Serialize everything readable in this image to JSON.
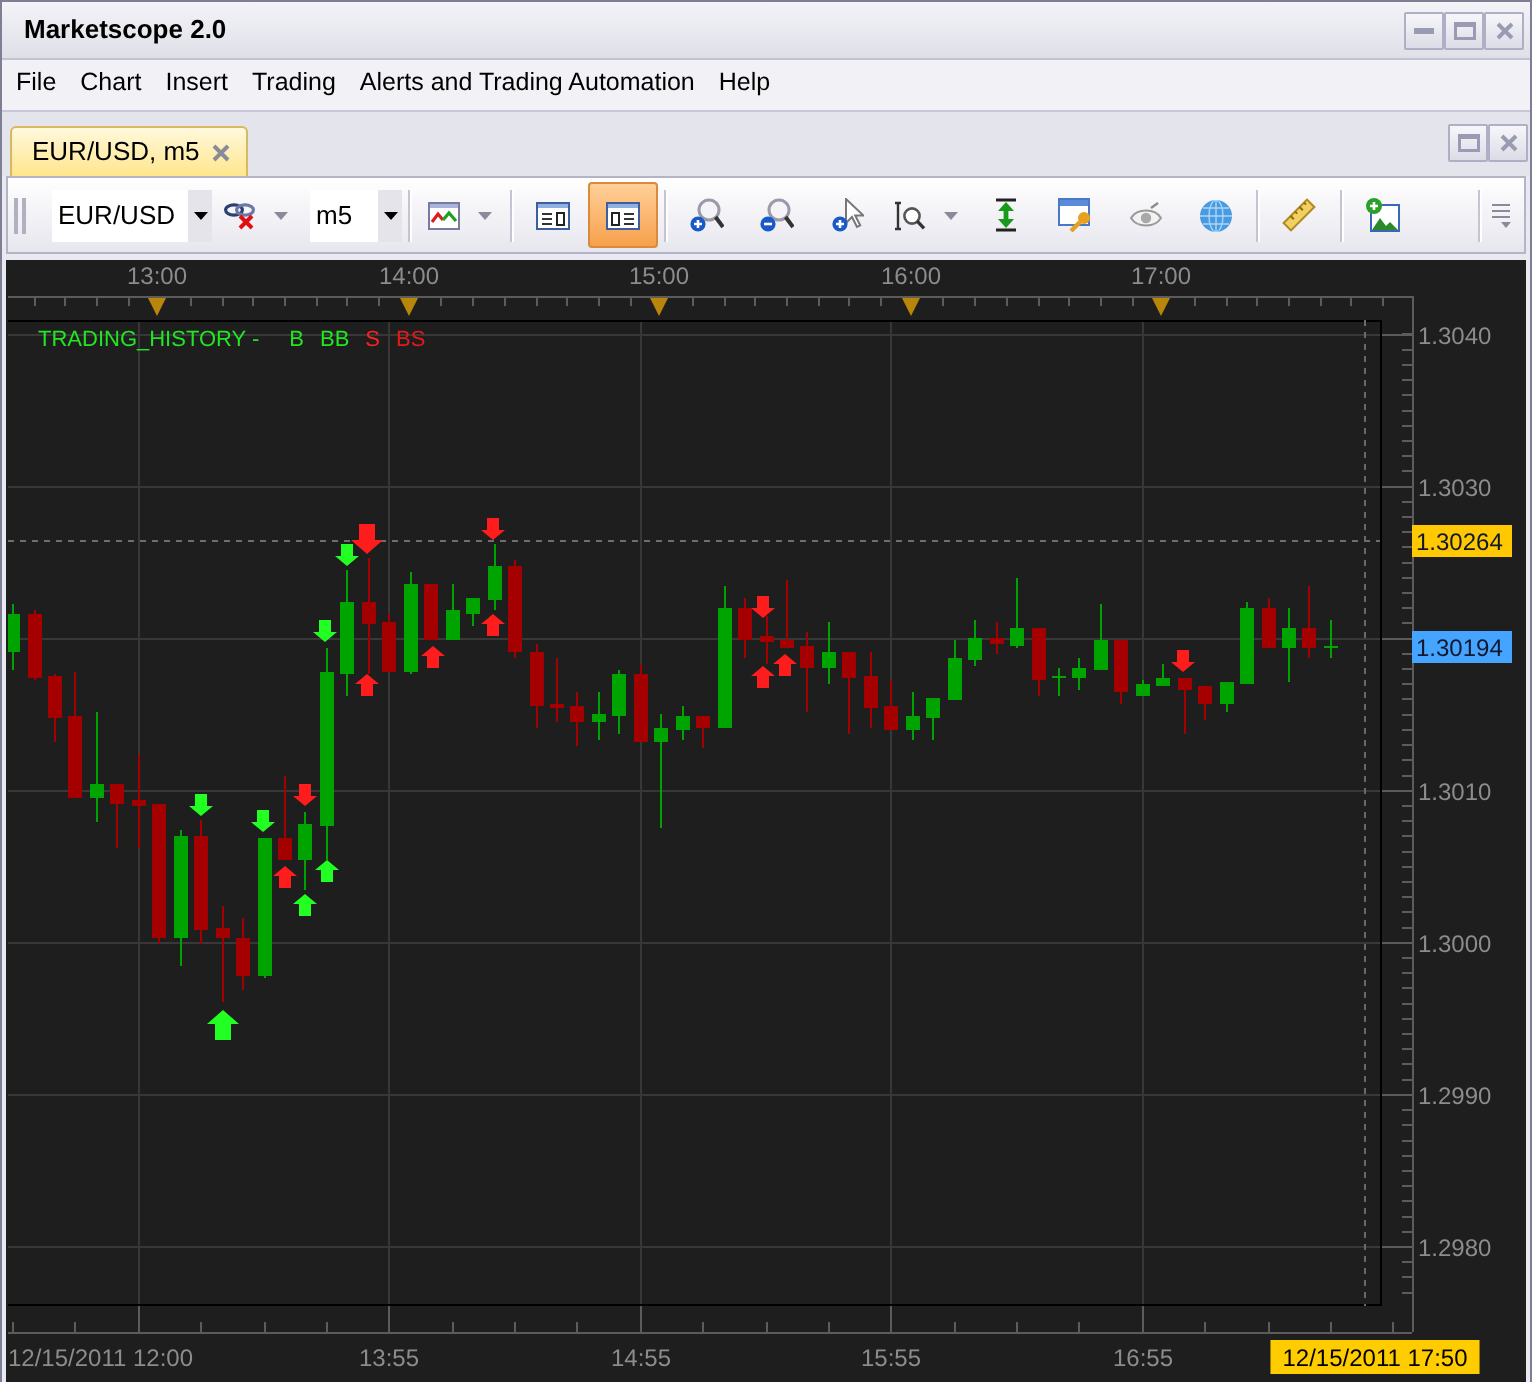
{
  "window": {
    "title": "Marketscope 2.0"
  },
  "menu": [
    "File",
    "Chart",
    "Insert",
    "Trading",
    "Alerts and Trading Automation",
    "Help"
  ],
  "tabs": [
    {
      "label": "EUR/USD, m5",
      "selected": true
    }
  ],
  "toolbar": {
    "groups": [
      [
        {
          "kind": "combo",
          "value": "EUR/USD"
        },
        {
          "kind": "unlink",
          "dropdown": true,
          "active": false
        },
        {
          "kind": "combo",
          "value": "m5"
        }
      ],
      [
        {
          "kind": "chart-type",
          "dropdown": true,
          "active": false
        }
      ],
      [
        {
          "kind": "view-b",
          "active": false
        },
        {
          "kind": "view-a",
          "active": true
        }
      ],
      [
        {
          "kind": "zoom-in",
          "active": false
        },
        {
          "kind": "zoom-out",
          "active": false
        },
        {
          "kind": "pointer",
          "active": false
        },
        {
          "kind": "zoom-range",
          "dropdown": true,
          "active": false
        },
        {
          "kind": "vertical-scale",
          "active": false
        },
        {
          "kind": "properties",
          "active": false
        },
        {
          "kind": "visibility",
          "active": false
        },
        {
          "kind": "globe",
          "active": false
        }
      ],
      [
        {
          "kind": "ruler",
          "active": false
        }
      ],
      [
        {
          "kind": "image",
          "active": false
        }
      ]
    ]
  },
  "chart": {
    "legend": [
      {
        "text": "TRADING_HISTORY -",
        "color": "#22e622"
      },
      {
        "text": "B",
        "color": "#22e622"
      },
      {
        "text": "BB",
        "color": "#22e622"
      },
      {
        "text": "S",
        "color": "#ff2020"
      },
      {
        "text": "BS",
        "color": "#e81818"
      }
    ],
    "price_tags": [
      {
        "kind": "bid",
        "text": "1.30194",
        "color": "#44a4ff"
      }
    ],
    "date_axis": [
      "12/15/2011 12:00",
      "13:55",
      "14:55",
      "15:55",
      "16:55"
    ],
    "cursor_date": "12/15/2011 17:50",
    "chart_data": {
      "type": "candlestick",
      "x": [
        745,
        750,
        755,
        760,
        765,
        770,
        775,
        780,
        785,
        790,
        795,
        800,
        805,
        810,
        815,
        820,
        825,
        830,
        835,
        840,
        845,
        850,
        855,
        860,
        865,
        870,
        875,
        880,
        885,
        890,
        895,
        900,
        905,
        910,
        915,
        920,
        925,
        930,
        935,
        940,
        945,
        950,
        955,
        960,
        965,
        970,
        975,
        980,
        985,
        990,
        995,
        1000,
        1005,
        1010,
        1015,
        1020,
        1025,
        1030,
        1035,
        1040,
        1045,
        1050,
        1055,
        1060
      ],
      "ohlc": [
        [
          1.3019,
          1.30222,
          1.30178,
          1.30215
        ],
        [
          1.30215,
          1.30218,
          1.30172,
          1.30173
        ],
        [
          1.30174,
          1.30176,
          1.30131,
          1.30147
        ],
        [
          1.30148,
          1.30177,
          1.30094,
          1.30094
        ],
        [
          1.30094,
          1.30151,
          1.30078,
          1.30103
        ],
        [
          1.30103,
          1.30103,
          1.30062,
          1.30091
        ],
        [
          1.30093,
          1.30123,
          1.30062,
          1.30089
        ],
        [
          1.3009,
          1.3009,
          1.29999,
          1.30002
        ],
        [
          1.30002,
          1.30073,
          1.29984,
          1.3007
        ],
        [
          1.3007,
          1.3008,
          1.29999,
          1.30007
        ],
        [
          1.30009,
          1.30024,
          1.2996,
          1.30002
        ],
        [
          1.30002,
          1.30015,
          1.29968,
          1.29977
        ],
        [
          1.29977,
          1.30068,
          1.29976,
          1.30068
        ],
        [
          1.30068,
          1.30109,
          1.30053,
          1.30053
        ],
        [
          1.30053,
          1.30085,
          1.30034,
          1.30077
        ],
        [
          1.30076,
          1.30193,
          1.30053,
          1.30177
        ],
        [
          1.30176,
          1.30244,
          1.30161,
          1.30223
        ],
        [
          1.30223,
          1.30252,
          1.30176,
          1.30209
        ],
        [
          1.3021,
          1.30216,
          1.30177,
          1.30177
        ],
        [
          1.30177,
          1.30243,
          1.30176,
          1.30235
        ],
        [
          1.30235,
          1.30235,
          1.30198,
          1.30198
        ],
        [
          1.30198,
          1.30235,
          1.30198,
          1.30218
        ],
        [
          1.30216,
          1.30226,
          1.30207,
          1.30226
        ],
        [
          1.30224,
          1.30261,
          1.30218,
          1.30247
        ],
        [
          1.30247,
          1.30251,
          1.30186,
          1.3019
        ],
        [
          1.30191,
          1.30195,
          1.30141,
          1.30155
        ],
        [
          1.30156,
          1.30186,
          1.30144,
          1.30153
        ],
        [
          1.30155,
          1.30164,
          1.30128,
          1.30144
        ],
        [
          1.30144,
          1.30164,
          1.30132,
          1.30149
        ],
        [
          1.30148,
          1.30178,
          1.30137,
          1.30176
        ],
        [
          1.30176,
          1.30182,
          1.30131,
          1.30131
        ],
        [
          1.30131,
          1.30149,
          1.30074,
          1.3014
        ],
        [
          1.30139,
          1.30155,
          1.30132,
          1.30148
        ],
        [
          1.30148,
          1.30148,
          1.30127,
          1.30141
        ],
        [
          1.30141,
          1.30234,
          1.3014,
          1.30219
        ],
        [
          1.30219,
          1.30226,
          1.30186,
          1.30198
        ],
        [
          1.30201,
          1.30214,
          1.30182,
          1.30197
        ],
        [
          1.30198,
          1.30238,
          1.30193,
          1.30193
        ],
        [
          1.30194,
          1.30203,
          1.30151,
          1.3018
        ],
        [
          1.3018,
          1.3021,
          1.30169,
          1.30191
        ],
        [
          1.30191,
          1.30191,
          1.30136,
          1.30173
        ],
        [
          1.30174,
          1.30191,
          1.3014,
          1.30153
        ],
        [
          1.30155,
          1.30172,
          1.30139,
          1.30139
        ],
        [
          1.30139,
          1.30164,
          1.30132,
          1.30148
        ],
        [
          1.30147,
          1.3016,
          1.30132,
          1.3016
        ],
        [
          1.30159,
          1.30198,
          1.30159,
          1.30186
        ],
        [
          1.30185,
          1.30211,
          1.30181,
          1.30199
        ],
        [
          1.30199,
          1.3021,
          1.30189,
          1.30195
        ],
        [
          1.30194,
          1.30239,
          1.30193,
          1.30206
        ],
        [
          1.30206,
          1.30206,
          1.30161,
          1.30172
        ],
        [
          1.30173,
          1.3018,
          1.30162,
          1.30174
        ],
        [
          1.30173,
          1.30186,
          1.30165,
          1.3018
        ],
        [
          1.30178,
          1.30222,
          1.30178,
          1.30198
        ],
        [
          1.30198,
          1.30198,
          1.30156,
          1.30164
        ],
        [
          1.30162,
          1.30172,
          1.30161,
          1.30169
        ],
        [
          1.30168,
          1.30182,
          1.30168,
          1.30173
        ],
        [
          1.30173,
          1.30173,
          1.30136,
          1.30166
        ],
        [
          1.30168,
          1.30168,
          1.30145,
          1.30156
        ],
        [
          1.30156,
          1.3017,
          1.30151,
          1.3017
        ],
        [
          1.30169,
          1.30223,
          1.30169,
          1.30219
        ],
        [
          1.30219,
          1.30226,
          1.30193,
          1.30193
        ],
        [
          1.30193,
          1.30219,
          1.3017,
          1.30206
        ],
        [
          1.30206,
          1.30234,
          1.30186,
          1.30193
        ],
        [
          1.30193,
          1.30211,
          1.30186,
          1.30194
        ]
      ],
      "xlim": [
        744,
        1072
      ],
      "ylim": [
        1.29761,
        1.30408
      ],
      "xticks": [
        {
          "value": 780,
          "label": "13:00"
        },
        {
          "value": 840,
          "label": "14:00"
        },
        {
          "value": 900,
          "label": "15:00"
        },
        {
          "value": 960,
          "label": "16:00"
        },
        {
          "value": 1020,
          "label": "17:00"
        }
      ],
      "yticks": [
        {
          "value": 1.304,
          "label": "1.3040"
        },
        {
          "value": 1.303,
          "label": "1.3030"
        },
        {
          "value": 1.301,
          "label": "1.3010"
        },
        {
          "value": 1.3,
          "label": "1.3000"
        },
        {
          "value": 1.299,
          "label": "1.2990"
        },
        {
          "value": 1.298,
          "label": "1.2980"
        }
      ],
      "grid": true,
      "ref_lines": [
        {
          "axis": "y",
          "value": 1.30264,
          "label": "1.30264",
          "color": "#6e6e6e"
        },
        {
          "axis": "x",
          "value": 1068,
          "color": "#6a6a6a"
        }
      ]
    }
  }
}
